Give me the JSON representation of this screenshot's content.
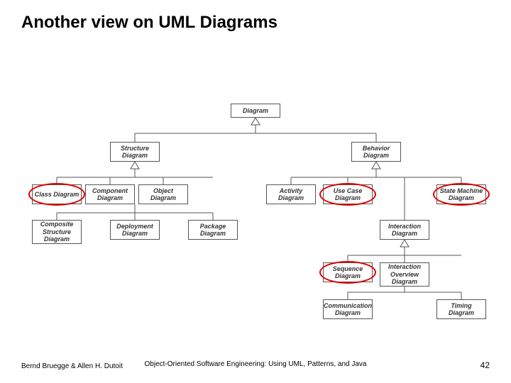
{
  "title": "Another view on UML Diagrams",
  "footer": {
    "left": "Bernd Bruegge & Allen H. Dutoit",
    "center": "Object-Oriented Software Engineering: Using UML, Patterns, and Java",
    "page": "42"
  },
  "nodes": {
    "diagram": "Diagram",
    "structure": "Structure\nDiagram",
    "behavior": "Behavior\nDiagram",
    "class": "Class Diagram",
    "component": "Component\nDiagram",
    "object": "Object\nDiagram",
    "composite": "Composite\nStructure\nDiagram",
    "deployment": "Deployment\nDiagram",
    "package": "Package\nDiagram",
    "activity": "Activity\nDiagram",
    "usecase": "Use Case\nDiagram",
    "statemachine": "State Machine\nDiagram",
    "interaction": "Interaction\nDiagram",
    "sequence": "Sequence\nDiagram",
    "intoverview": "Interaction\nOverview\nDiagram",
    "communication": "Communication\nDiagram",
    "timing": "Timing\nDiagram"
  },
  "highlighted": [
    "class",
    "usecase",
    "statemachine",
    "sequence"
  ]
}
